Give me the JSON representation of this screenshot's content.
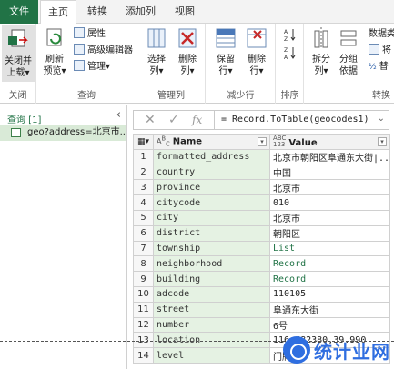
{
  "tabs": [
    "文件",
    "主页",
    "转换",
    "添加列",
    "视图"
  ],
  "ribbon": {
    "close": {
      "label1": "关闭并",
      "label2": "上载▾",
      "group": "关闭"
    },
    "query": {
      "refresh1": "刷新",
      "refresh2": "预览▾",
      "properties": "属性",
      "advanced_editor": "高级编辑器",
      "manage": "管理▾",
      "group": "查询"
    },
    "manage_cols": {
      "choose1": "选择",
      "choose2": "列▾",
      "remove1": "删除",
      "remove2": "列▾",
      "group": "管理列"
    },
    "reduce_rows": {
      "keep1": "保留",
      "keep2": "行▾",
      "remove1": "删除",
      "remove2": "行▾",
      "group": "减少行"
    },
    "sort": {
      "group": "排序"
    },
    "transform": {
      "split1": "拆分",
      "split2": "列▾",
      "groupby1": "分组",
      "groupby2": "依据",
      "datatype": "数据类",
      "replace_first": "将",
      "replace_vals": "替",
      "group": "转换"
    }
  },
  "left_pane": {
    "queries_label": "查询 [1]",
    "item": "geo?address=北京市..."
  },
  "formula": "= Record.ToTable(geocodes1)",
  "table": {
    "headers": [
      "Name",
      "Value"
    ],
    "type_icons": [
      "AᴮC",
      "ABC\n123"
    ],
    "rows": [
      {
        "n": "1",
        "name": "formatted_address",
        "value": "北京市朝阳区阜通东大街|...",
        "kind": "text"
      },
      {
        "n": "2",
        "name": "country",
        "value": "中国",
        "kind": "text"
      },
      {
        "n": "3",
        "name": "province",
        "value": "北京市",
        "kind": "text"
      },
      {
        "n": "4",
        "name": "citycode",
        "value": "010",
        "kind": "text"
      },
      {
        "n": "5",
        "name": "city",
        "value": "北京市",
        "kind": "text"
      },
      {
        "n": "6",
        "name": "district",
        "value": "朝阳区",
        "kind": "text"
      },
      {
        "n": "7",
        "name": "township",
        "value": "List",
        "kind": "list"
      },
      {
        "n": "8",
        "name": "neighborhood",
        "value": "Record",
        "kind": "record"
      },
      {
        "n": "9",
        "name": "building",
        "value": "Record",
        "kind": "record"
      },
      {
        "n": "10",
        "name": "adcode",
        "value": "110105",
        "kind": "text"
      },
      {
        "n": "11",
        "name": "street",
        "value": "阜通东大街",
        "kind": "text"
      },
      {
        "n": "12",
        "name": "number",
        "value": "6号",
        "kind": "text"
      },
      {
        "n": "13",
        "name": "location",
        "value": "116.482380,39.990",
        "kind": "text"
      },
      {
        "n": "14",
        "name": "level",
        "value": "门牌号",
        "kind": "text"
      }
    ]
  },
  "watermark": "统计业网"
}
